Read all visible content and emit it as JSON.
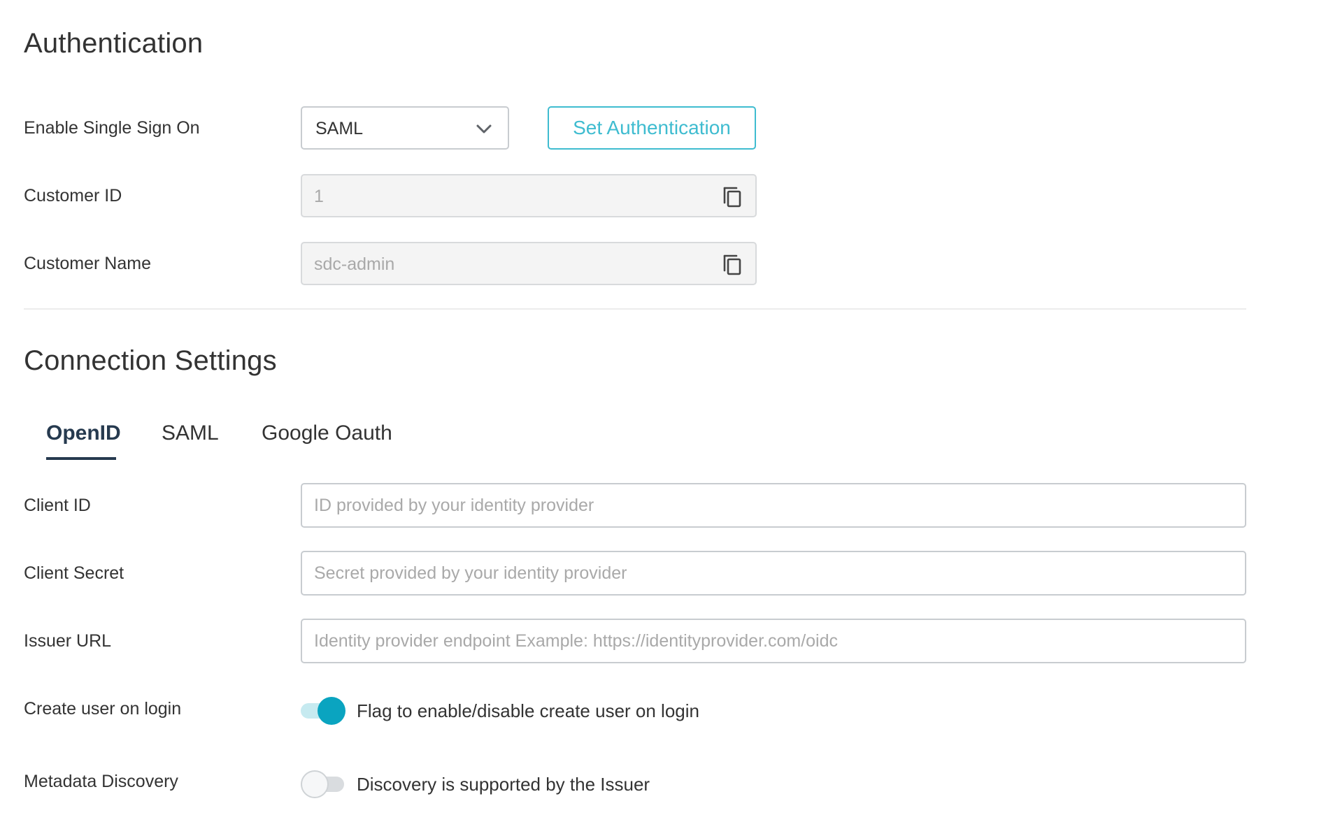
{
  "authentication": {
    "title": "Authentication",
    "sso": {
      "label": "Enable Single Sign On",
      "selected": "SAML"
    },
    "set_button": "Set Authentication",
    "customer_id": {
      "label": "Customer ID",
      "value": "1"
    },
    "customer_name": {
      "label": "Customer Name",
      "value": "sdc-admin"
    }
  },
  "connection": {
    "title": "Connection Settings",
    "tabs": [
      {
        "label": "OpenID",
        "active": true
      },
      {
        "label": "SAML",
        "active": false
      },
      {
        "label": "Google Oauth",
        "active": false
      }
    ],
    "client_id": {
      "label": "Client ID",
      "value": "",
      "placeholder": "ID provided by your identity provider"
    },
    "client_secret": {
      "label": "Client Secret",
      "value": "",
      "placeholder": "Secret provided by your identity provider"
    },
    "issuer_url": {
      "label": "Issuer URL",
      "value": "",
      "placeholder": "Identity provider endpoint Example: https://identityprovider.com/oidc"
    },
    "create_user": {
      "label": "Create user on login",
      "enabled": true,
      "description": "Flag to enable/disable create user on login"
    },
    "metadata_discovery": {
      "label": "Metadata Discovery",
      "enabled": false,
      "description": "Discovery is supported by the Issuer"
    }
  },
  "colors": {
    "accent": "#3fbcd0",
    "toggle_on": "#0aa4c0",
    "active_tab": "#263a4f",
    "text": "#333333",
    "placeholder": "#a9a9a9"
  },
  "icons": {
    "select_chevron": "chevron-down-icon",
    "copy": "copy-icon"
  }
}
